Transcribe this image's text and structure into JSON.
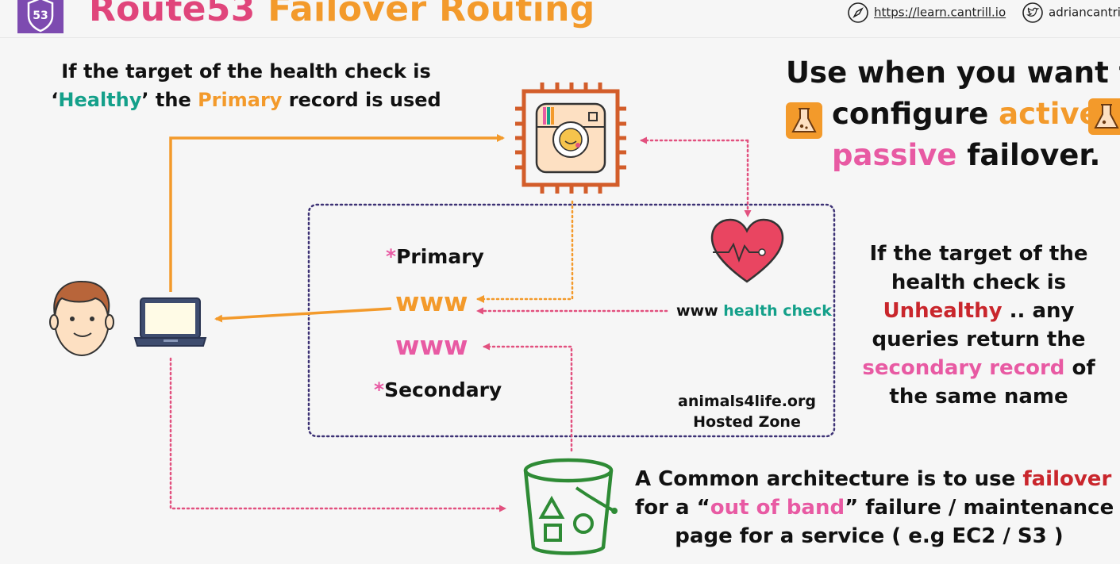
{
  "header": {
    "logo_text": "53",
    "title_part1": "Route53",
    "title_part2": "Failover Routing",
    "link_url": "https://learn.cantrill.io",
    "twitter_handle": "adriancantri",
    "link_icon": "compass-icon",
    "twitter_icon": "twitter-icon"
  },
  "healthy_note": {
    "line1": "If the target of the health check is",
    "q_open": "‘",
    "healthy": "Healthy",
    "q_close": "’ the ",
    "primary": "Primary",
    "tail": " record is used"
  },
  "use_when": {
    "line1": "Use when you want to",
    "configure": "configure ",
    "active": "active",
    "passive": "passive",
    "failover": " failover."
  },
  "hosted_zone": {
    "primary_star": "*",
    "primary_label": "Primary",
    "www_primary": "www",
    "www_secondary": "www",
    "secondary_star": "*",
    "secondary_label": "Secondary",
    "health_check_prefix": "www ",
    "health_check_label": "health check",
    "zone_name": "animals4life.org",
    "zone_type": "Hosted Zone"
  },
  "unhealthy_note": {
    "l1": "If the target of the",
    "l2": "health check is",
    "unhealthy": "Unhealthy",
    "l3_rest": " .. any",
    "l4": "queries return the",
    "secondary_record": "secondary record",
    "l5_rest": " of",
    "l6": "the same name"
  },
  "common_note": {
    "l1_pre": "A Common architecture is to use ",
    "failover": "failover",
    "l2_pre": "for a “",
    "out_of_band": "out of band",
    "l2_post": "” failure / maintenance",
    "l3": "page for a service ( e.g EC2 / S3 )"
  },
  "icons": [
    "user-avatar-icon",
    "laptop-icon",
    "ec2-instance-icon",
    "heart-health-icon",
    "s3-bucket-icon",
    "flask-icon"
  ],
  "colors": {
    "orange": "#f39a2b",
    "pink": "#e85aa3",
    "green": "#14a08a",
    "red": "#c9262c",
    "purple": "#5b3f8c",
    "ec2": "#d35d2a",
    "s3": "#2e8b35"
  }
}
